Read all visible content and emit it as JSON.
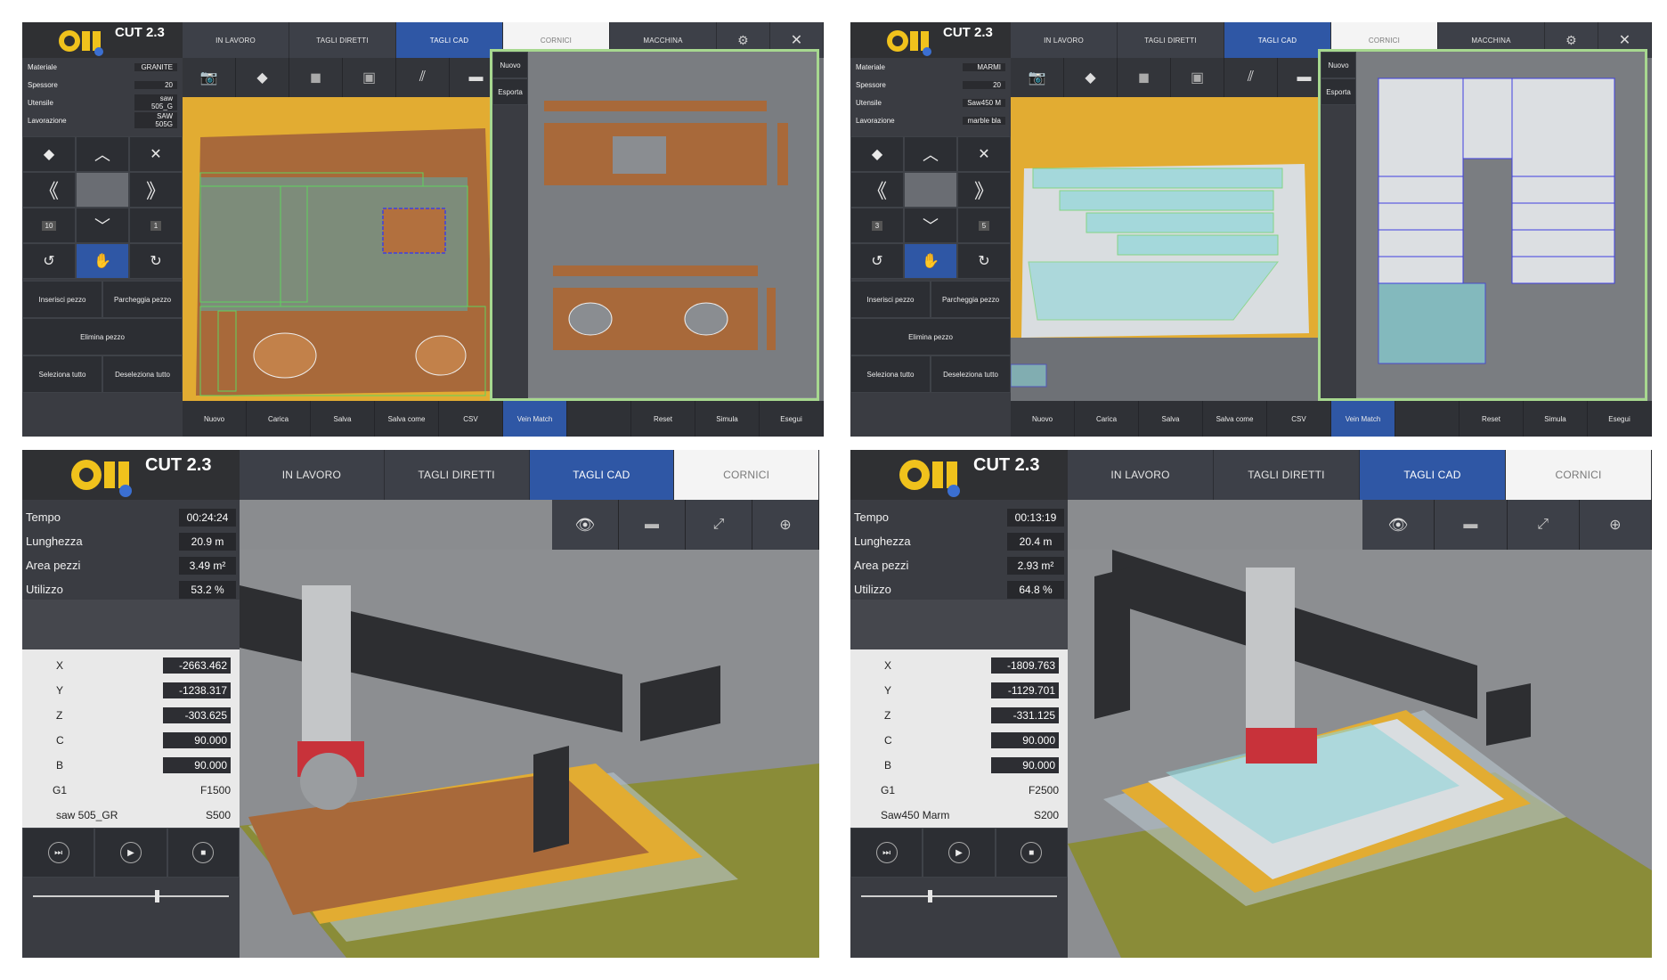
{
  "app": {
    "version": "CUT 2.3"
  },
  "tabs_full": [
    "IN LAVORO",
    "TAGLI DIRETTI",
    "TAGLI CAD",
    "CORNICI",
    "MACCHINA"
  ],
  "tabs_short": [
    "IN LAVORO",
    "TAGLI DIRETTI",
    "TAGLI CAD",
    "CORNICI"
  ],
  "props_labels": [
    "Materiale",
    "Spessore",
    "Utensile",
    "Lavorazione"
  ],
  "screen1": {
    "props": [
      "GRANITE",
      "20",
      "saw 505_G",
      "SAW 505G"
    ],
    "step_left": "10",
    "step_right": "1"
  },
  "screen2": {
    "props": [
      "MARMI",
      "20",
      "Saw450 M",
      "marble bla"
    ],
    "step_left": "3",
    "step_right": "5"
  },
  "panel_buttons": {
    "insert": "Inserisci pezzo",
    "park": "Parcheggia pezzo",
    "delete": "Elimina pezzo",
    "select_all": "Seleziona tutto",
    "deselect_all": "Deseleziona tutto"
  },
  "side_menu": {
    "new": "Nuovo",
    "export": "Esporta"
  },
  "bottom_bar": [
    "Nuovo",
    "Carica",
    "Salva",
    "Salva come",
    "CSV",
    "Vein Match",
    "",
    "Reset",
    "Simula",
    "Esegui"
  ],
  "stats_labels": [
    "Tempo",
    "Lunghezza",
    "Area pezzi",
    "Utilizzo"
  ],
  "coord_labels": [
    "X",
    "Y",
    "Z",
    "C",
    "B"
  ],
  "screen3": {
    "stats": [
      "00:24:24",
      "20.9 m",
      "3.49 m²",
      "53.2 %"
    ],
    "coords": [
      "-2663.462",
      "-1238.317",
      "-303.625",
      "90.000",
      "90.000"
    ],
    "g_code": "G1",
    "feed": "F1500",
    "tool": "saw 505_GR",
    "speed": "S500",
    "progress": 0.63
  },
  "screen4": {
    "stats": [
      "00:13:19",
      "20.4 m",
      "2.93 m²",
      "64.8 %"
    ],
    "coords": [
      "-1809.763",
      "-1129.701",
      "-331.125",
      "90.000",
      "90.000"
    ],
    "g_code": "G1",
    "feed": "F2500",
    "tool": "Saw450 Marm",
    "speed": "S200",
    "progress": 0.35
  },
  "colors": {
    "active_tab": "#2f57a5",
    "panel": "#3a3c42",
    "slab_granite": "#a8693a",
    "slab_marble": "#d9dde0",
    "table_yellow": "#e6b030"
  }
}
